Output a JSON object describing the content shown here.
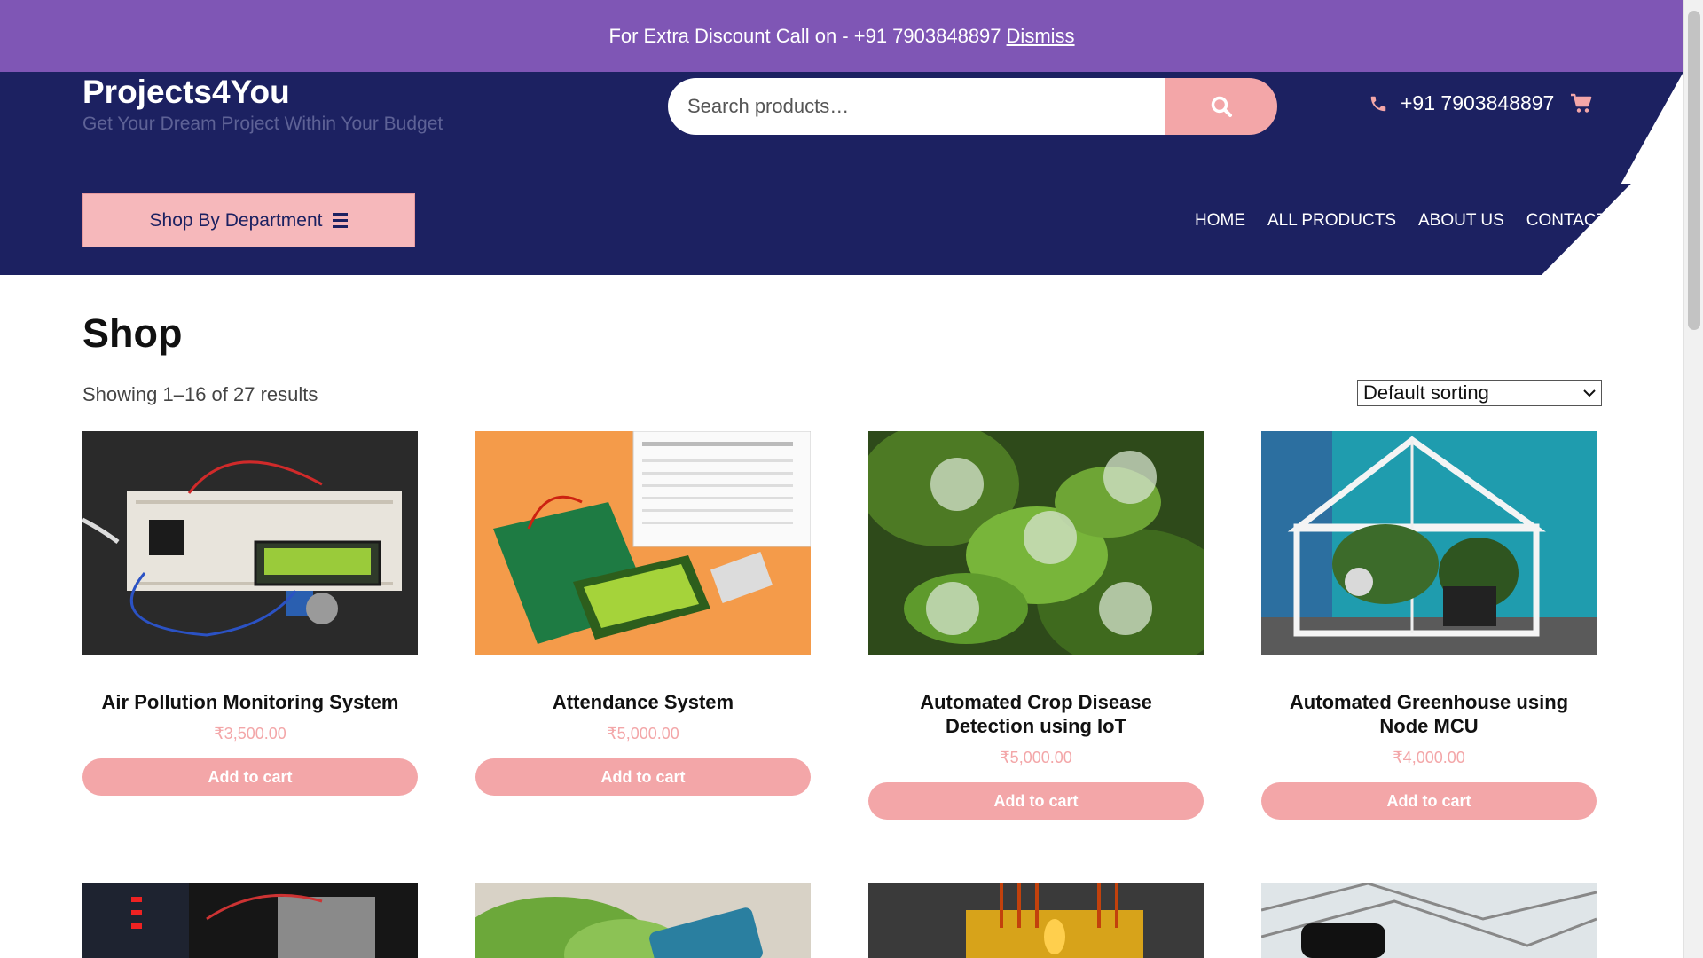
{
  "notice": {
    "text": "For Extra Discount Call on - +91 7903848897",
    "dismiss": "Dismiss"
  },
  "brand": {
    "title": "Projects4You",
    "tagline": "Get Your Dream Project Within Your Budget"
  },
  "search": {
    "placeholder": "Search products…"
  },
  "contact": {
    "phone": "+91 7903848897"
  },
  "department": {
    "label": "Shop By Department"
  },
  "nav": {
    "items": [
      "HOME",
      "ALL PRODUCTS",
      "ABOUT US",
      "CONTACT U"
    ]
  },
  "shop": {
    "title": "Shop",
    "result_count": "Showing 1–16 of 27 results",
    "sort_selected": "Default sorting"
  },
  "products": [
    {
      "name": "Air Pollution Monitoring System",
      "price": "₹3,500.00",
      "button": "Add to cart"
    },
    {
      "name": "Attendance System",
      "price": "₹5,000.00",
      "button": "Add to cart"
    },
    {
      "name": "Automated Crop Disease Detection using IoT",
      "price": "₹5,000.00",
      "button": "Add to cart"
    },
    {
      "name": "Automated Greenhouse using Node MCU",
      "price": "₹4,000.00",
      "button": "Add to cart"
    }
  ],
  "colors": {
    "purple": "#7f56b5",
    "navy": "#1c2161",
    "pink": "#f3a6a8"
  }
}
